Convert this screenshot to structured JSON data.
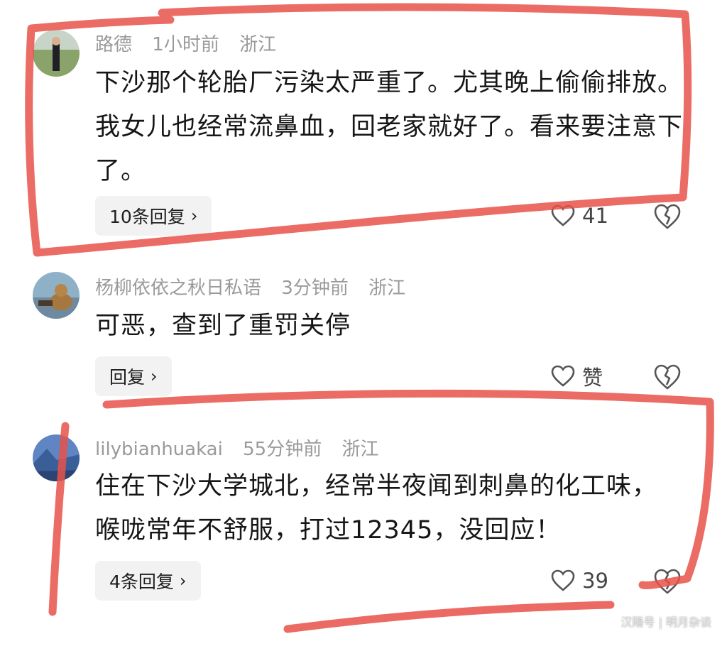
{
  "comments": [
    {
      "username": "路德",
      "time": "1小时前",
      "location": "浙江",
      "text": "下沙那个轮胎厂污染太严重了。尤其晚上偷偷排放。我女儿也经常流鼻血，回老家就好了。看来要注意下了。",
      "reply_label": "10条回复",
      "likes": "41"
    },
    {
      "username": "杨柳依依之秋日私语",
      "time": "3分钟前",
      "location": "浙江",
      "text": "可恶，查到了重罚关停",
      "reply_label": "回复",
      "likes": "赞"
    },
    {
      "username": "lilybianhuakai",
      "time": "55分钟前",
      "location": "浙江",
      "text": "住在下沙大学城北，经常半夜闻到刺鼻的化工味，喉咙常年不舒服，打过12345，没回应！",
      "reply_label": "4条回复",
      "likes": "39"
    }
  ],
  "watermark": "汉陽号 | 明月杂谈",
  "colors": {
    "marker": "#e8524a",
    "meta": "#9a9a9a",
    "reply_bg": "#f2f2f2"
  }
}
